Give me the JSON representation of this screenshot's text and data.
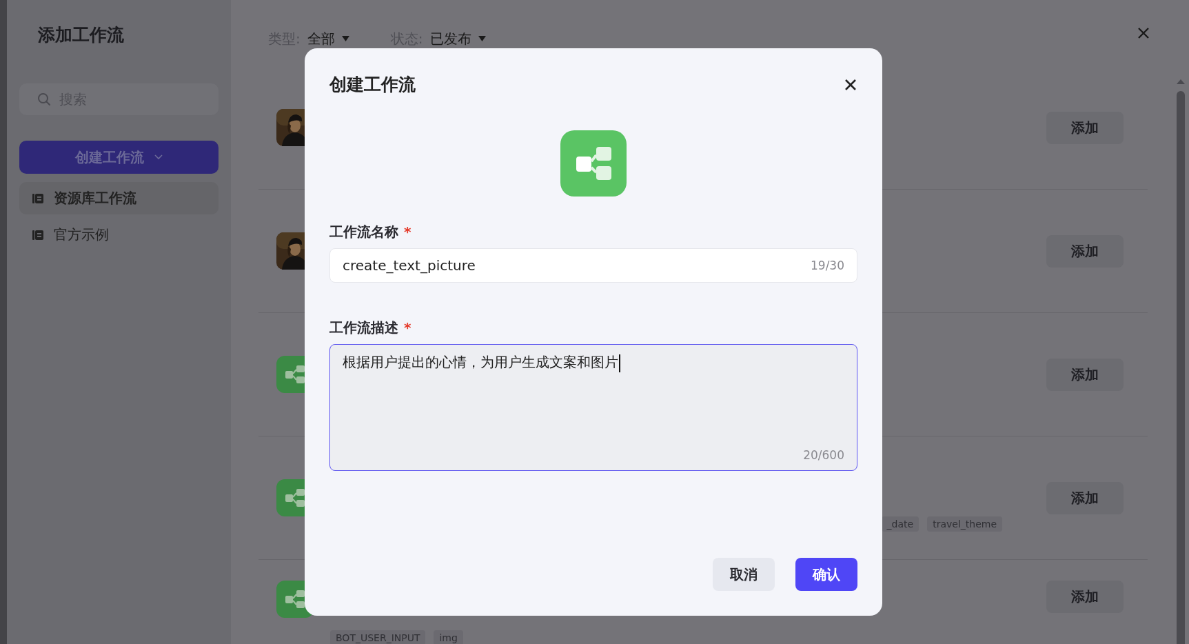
{
  "drawer": {
    "title": "添加工作流",
    "search": {
      "placeholder": "搜索"
    },
    "create_button": "创建工作流",
    "nav": [
      {
        "label": "资源库工作流",
        "selected": true
      },
      {
        "label": "官方示例",
        "selected": false
      }
    ],
    "filters": [
      {
        "label": "类型:",
        "value": "全部"
      },
      {
        "label": "状态:",
        "value": "已发布"
      }
    ],
    "rows": [
      {
        "kind": "picture",
        "button": "添加"
      },
      {
        "kind": "picture",
        "button": "添加"
      },
      {
        "kind": "workflow",
        "button": "添加"
      },
      {
        "kind": "workflow",
        "button": "添加",
        "trailing_tags": [
          "_date",
          "travel_theme"
        ]
      },
      {
        "kind": "workflow",
        "button": "添加",
        "tags": [
          "BOT_USER_INPUT",
          "img"
        ]
      }
    ]
  },
  "dialog": {
    "title": "创建工作流",
    "name_field": {
      "label": "工作流名称",
      "required_mark": "*",
      "value": "create_text_picture",
      "counter": "19/30"
    },
    "description_field": {
      "label": "工作流描述",
      "required_mark": "*",
      "value": "根据用户提出的心情，为用户生成文案和图片",
      "counter": "20/600",
      "focused": true
    },
    "buttons": [
      {
        "kind": "secondary",
        "label": "取消"
      },
      {
        "kind": "primary",
        "label": "确认"
      }
    ]
  }
}
